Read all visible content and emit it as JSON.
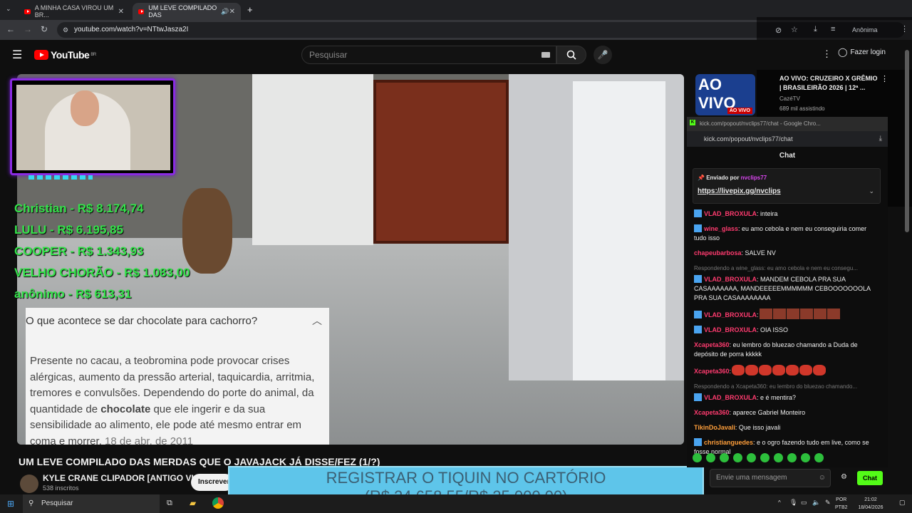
{
  "browser": {
    "tabs": [
      {
        "title": "A MINHA CASA VIROU UM BR..."
      },
      {
        "title": "UM LEVE COMPILADO DAS"
      }
    ],
    "url": "youtube.com/watch?v=NTtwJasza2I",
    "profile_label": "Anônima"
  },
  "youtube": {
    "logo_text": "YouTube",
    "region": "BR",
    "search_placeholder": "Pesquisar",
    "login_label": "Fazer login"
  },
  "video_overlay": {
    "donors": [
      "Christian - R$ 8.174,74",
      "LULU - R$ 6.195,85",
      "COOPER - R$ 1.343,93",
      "VELHO CHORÃO - R$ 1.083,00",
      "anônimo - R$ 613,31"
    ],
    "card_question": "O que acontece se dar chocolate para cachorro?",
    "card_answer_pre": "Presente no cacau, a teobromina pode provocar crises alérgicas, aumento da pressão arterial, taquicardia, arritmia, tremores e convulsões. Dependendo do porte do animal, da quantidade de ",
    "card_answer_bold": "chocolate",
    "card_answer_post": " que ele ingerir e da sua sensibilidade ao alimento, ele pode até mesmo entrar em coma e morrer.",
    "card_date": "18 de abr. de 2011",
    "goal_line1": "REGISTRAR O TIQUIN NO CARTÓRIO",
    "goal_line2": "(R$ 24.658,55/R$ 25.000,00)"
  },
  "video_info": {
    "title": "UM LEVE COMPILADO DAS MERDAS QUE O JAVAJACK JÁ DISSE/FEZ (1/?)",
    "channel": "KYLE CRANE CLIPADOR [ANTIGO VLAD]",
    "subscribers": "538 inscritos",
    "subscribe_label": "Inscrever-"
  },
  "recommended": {
    "thumb_text": "AO VIVO",
    "live_badge": "AO VIVO",
    "title": "AO VIVO: CRUZEIRO X GRÊMIO | BRASILEIRÃO 2026 | 12ª ...",
    "channel": "CazéTV",
    "viewers": "689 mil assistindo"
  },
  "popout": {
    "window_title": "kick.com/popout/nvclips77/chat - Google Chro...",
    "url": "kick.com/popout/nvclips77/chat"
  },
  "chat": {
    "header": "Chat",
    "pinned_by": "Enviado por",
    "pinned_user": "nvclips77",
    "pinned_link": "https://livepix.gg/nvclips",
    "input_placeholder": "Envie uma mensagem",
    "send_label": "Chat",
    "messages": [
      {
        "user": "VLAD_BROXULA",
        "text": ": inteira",
        "badge": true
      },
      {
        "user": "wine_glass",
        "text": ": eu amo cebola e nem eu conseguiria comer tudo isso",
        "badge": true
      },
      {
        "user": "chapeubarbosa",
        "text": ": SALVE NV",
        "badge": false
      },
      {
        "reply": "Respondendo a wine_glass: eu amo cebola e nem eu consegu...",
        "user": "VLAD_BROXULA",
        "text": ": MANDEM CEBOLA PRA SUA CASAAAAAAA, MANDEEEEEMMMMMM CEBOOOOOOOLA PRA SUA CASAAAAAAAA",
        "badge": true
      },
      {
        "user": "VLAD_BROXULA",
        "text": ":",
        "badge": true,
        "emotes": 6,
        "emote_style": "brown"
      },
      {
        "user": "VLAD_BROXULA",
        "text": ": OIA ISSO",
        "badge": true
      },
      {
        "user": "Xcapeta360",
        "text": ": eu lembro do bluezao chamando a Duda de depósito de porra kkkkk",
        "badge": false
      },
      {
        "user": "Xcapeta360",
        "text": ":",
        "badge": false,
        "emotes": 7,
        "emote_style": "red"
      },
      {
        "reply": "Respondendo a Xcapeta360: eu lembro do bluezao chamando...",
        "user": "VLAD_BROXULA",
        "text": ": e é mentira?",
        "badge": true
      },
      {
        "user": "Xcapeta360",
        "text": ": aparece Gabriel Monteiro",
        "badge": false
      },
      {
        "user": "TikinDoJavali",
        "text": ": Que isso javali",
        "badge": false,
        "orange": true
      },
      {
        "user": "christianguedes",
        "text": ": e o ogro fazendo tudo em live, como se fosse normal",
        "badge": true,
        "orange": true
      }
    ]
  },
  "taskbar": {
    "search_label": "Pesquisar",
    "lang": "POR",
    "layout": "PTB2",
    "time": "21:02",
    "date": "18/04/2026"
  }
}
